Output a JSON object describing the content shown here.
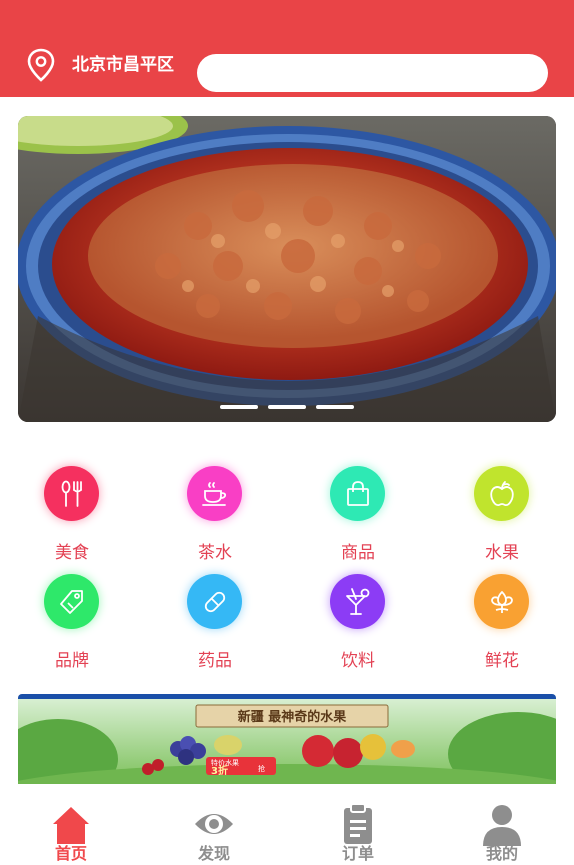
{
  "header": {
    "location": "北京市昌平区",
    "search_placeholder": ""
  },
  "banner": {
    "image": "food-bowl-image",
    "slides": 3
  },
  "categories": [
    {
      "label": "美食",
      "icon": "fork-knife-icon",
      "color": "#f5305f"
    },
    {
      "label": "茶水",
      "icon": "tea-cup-icon",
      "color": "#f93fc5"
    },
    {
      "label": "商品",
      "icon": "shopping-bag-icon",
      "color": "#2ee9b4"
    },
    {
      "label": "水果",
      "icon": "apple-icon",
      "color": "#c0e42d"
    },
    {
      "label": "品牌",
      "icon": "tag-icon",
      "color": "#2ee86a"
    },
    {
      "label": "药品",
      "icon": "pill-icon",
      "color": "#35b8f5"
    },
    {
      "label": "饮料",
      "icon": "cocktail-icon",
      "color": "#8c3cf5"
    },
    {
      "label": "鲜花",
      "icon": "flower-icon",
      "color": "#f9a132"
    }
  ],
  "promo": {
    "title": "新疆 最神奇的水果",
    "tag": "3折",
    "tag_prefix": "特价水果",
    "tag_suffix": "抢"
  },
  "tabbar": [
    {
      "label": "首页",
      "icon": "home-icon",
      "active": true
    },
    {
      "label": "发现",
      "icon": "eye-icon",
      "active": false
    },
    {
      "label": "订单",
      "icon": "clipboard-icon",
      "active": false
    },
    {
      "label": "我的",
      "icon": "user-icon",
      "active": false
    }
  ],
  "colors": {
    "brand": "#e94447",
    "active_tab": "#f0484b",
    "inactive_tab": "#8e8e8e",
    "category_label": "#e34254"
  }
}
